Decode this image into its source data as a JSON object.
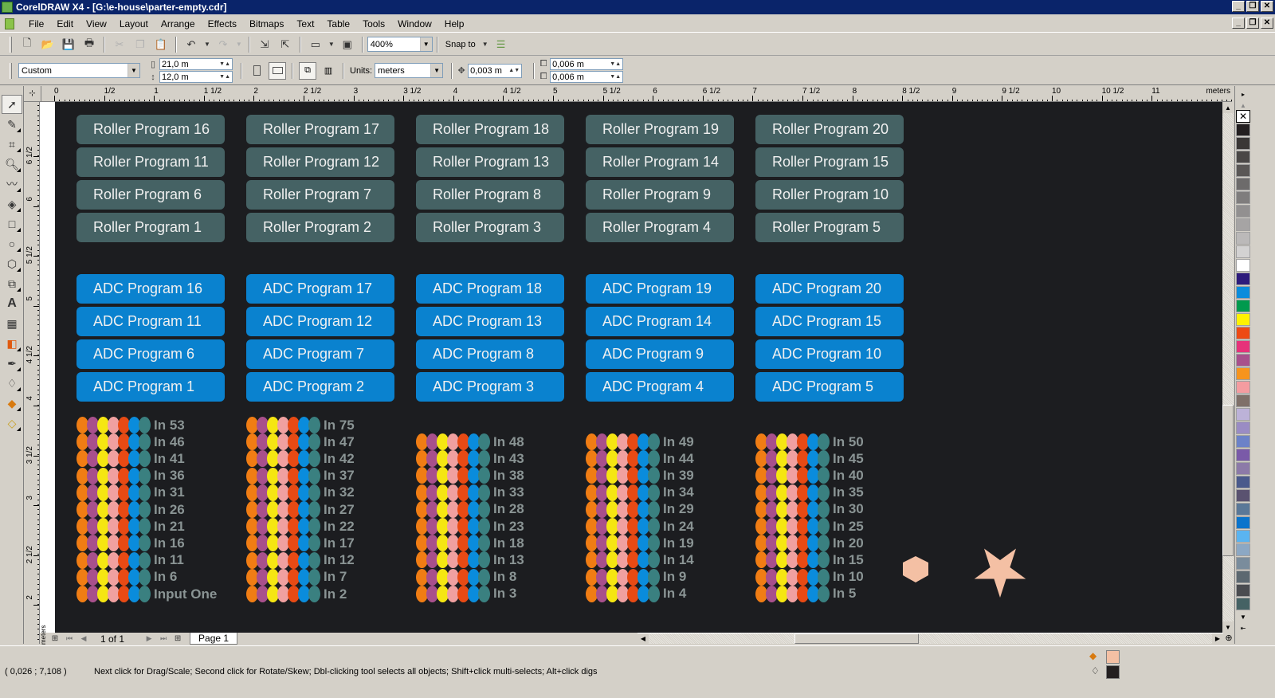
{
  "window": {
    "title": "CorelDRAW X4 - [G:\\e-house\\parter-empty.cdr]",
    "controls": {
      "minimize": "_",
      "restore": "❐",
      "close": "✕"
    }
  },
  "menu": [
    "File",
    "Edit",
    "View",
    "Layout",
    "Arrange",
    "Effects",
    "Bitmaps",
    "Text",
    "Table",
    "Tools",
    "Window",
    "Help"
  ],
  "toolbar": {
    "zoom_level": "400%",
    "snap_to": "Snap to"
  },
  "property_bar": {
    "paper_preset": "Custom",
    "width": "21,0 m",
    "height": "12,0 m",
    "units_label": "Units:",
    "units": "meters",
    "nudge": "0,003 m",
    "dup_x": "0,006 m",
    "dup_y": "0,006 m"
  },
  "rulers": {
    "horizontal": [
      "0",
      "1/2",
      "1",
      "1 1/2",
      "2",
      "2 1/2",
      "3",
      "3 1/2",
      "4",
      "4 1/2",
      "5",
      "5 1/2",
      "6",
      "6 1/2",
      "7",
      "7 1/2",
      "8",
      "8 1/2",
      "9",
      "9 1/2",
      "10",
      "10 1/2",
      "11"
    ],
    "horizontal_unit": "meters",
    "vertical": [
      "6 1/2",
      "6",
      "5 1/2",
      "5",
      "4 1/2",
      "4",
      "3 1/2",
      "3",
      "2 1/2",
      "2"
    ],
    "vertical_unit": "meters"
  },
  "canvas": {
    "roller_buttons": [
      [
        "Roller Program 16",
        "Roller Program 17",
        "Roller Program 18",
        "Roller Program 19",
        "Roller Program 20"
      ],
      [
        "Roller Program 11",
        "Roller Program 12",
        "Roller Program 13",
        "Roller Program 14",
        "Roller Program 15"
      ],
      [
        "Roller Program 6",
        "Roller Program 7",
        "Roller Program 8",
        "Roller Program 9",
        "Roller Program 10"
      ],
      [
        "Roller Program 1",
        "Roller Program 2",
        "Roller Program 3",
        "Roller Program 4",
        "Roller Program 5"
      ]
    ],
    "adc_buttons": [
      [
        "ADC Program 16",
        "ADC Program 17",
        "ADC Program 18",
        "ADC Program 19",
        "ADC Program 20"
      ],
      [
        "ADC Program 11",
        "ADC Program 12",
        "ADC Program 13",
        "ADC Program 14",
        "ADC Program 15"
      ],
      [
        "ADC Program 6",
        "ADC Program 7",
        "ADC Program 8",
        "ADC Program 9",
        "ADC Program 10"
      ],
      [
        "ADC Program 1",
        "ADC Program 2",
        "ADC Program 3",
        "ADC Program 4",
        "ADC Program 5"
      ]
    ],
    "input_columns": [
      [
        "In 53",
        "In 46",
        "In 41",
        "In 36",
        "In 31",
        "In 26",
        "In 21",
        "In 16",
        "In 11",
        "In 6",
        "Input One"
      ],
      [
        "In 75",
        "In 47",
        "In 42",
        "In 37",
        "In 32",
        "In 27",
        "In 22",
        "In 17",
        "In 12",
        "In 7",
        "In 2"
      ],
      [
        "In 48",
        "In 43",
        "In 38",
        "In 33",
        "In 28",
        "In 23",
        "In 18",
        "In 13",
        "In 8",
        "In 3"
      ],
      [
        "In 49",
        "In 44",
        "In 39",
        "In 34",
        "In 29",
        "In 24",
        "In 19",
        "In 14",
        "In 9",
        "In 4"
      ],
      [
        "In 50",
        "In 45",
        "In 40",
        "In 35",
        "In 30",
        "In 25",
        "In 20",
        "In 15",
        "In 10",
        "In 5"
      ]
    ],
    "dot_colors": [
      "#f07d14",
      "#a8508c",
      "#f5e612",
      "#f0a0a0",
      "#e84a14",
      "#0a8cdc",
      "#3a8080"
    ],
    "shape_color": "#f4c0a4"
  },
  "palette": [
    "#231f20",
    "#3a3736",
    "#4a4746",
    "#5a5756",
    "#6d6b6b",
    "#7f7d7d",
    "#929090",
    "#a6a4a4",
    "#bbb9b9",
    "#d3d2d2",
    "#ffffff",
    "#2d1b7c",
    "#0a8cdc",
    "#009a4e",
    "#fff200",
    "#ee4a14",
    "#e6327a",
    "#a8508c",
    "#f7941d",
    "#f49ca0",
    "#7f7069",
    "#bcb2d8",
    "#9a8cc4",
    "#6c82c8",
    "#7a5aa8",
    "#8c7aa8",
    "#4a5a8c",
    "#5a5270",
    "#5a7898",
    "#0a74cc",
    "#5ab4f0",
    "#8ca8c4",
    "#7a8c9c",
    "#5c6870",
    "#4a4c50",
    "#456264"
  ],
  "page_nav": {
    "counter": "1 of 1",
    "tab": "Page 1"
  },
  "status": {
    "coords": "( 0,026 ; 7,108 )",
    "hint": "Next click for Drag/Scale; Second click for Rotate/Skew; Dbl-clicking tool selects all objects; Shift+click multi-selects; Alt+click digs",
    "fill_color": "#f4c0a4",
    "outline_color": "#231f20"
  }
}
